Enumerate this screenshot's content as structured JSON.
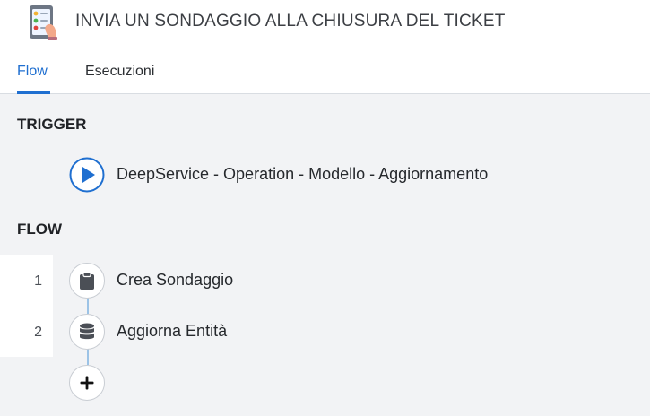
{
  "header": {
    "title": "INVIA UN SONDAGGIO ALLA CHIUSURA DEL TICKET",
    "icon": "survey-tablet-icon"
  },
  "tabs": [
    {
      "label": "Flow",
      "active": true
    },
    {
      "label": "Esecuzioni",
      "active": false
    }
  ],
  "trigger": {
    "section_label": "TRIGGER",
    "name": "DeepService - Operation - Modello - Aggiornamento",
    "icon": "play-icon"
  },
  "flow": {
    "section_label": "FLOW",
    "steps": [
      {
        "number": "1",
        "label": "Crea Sondaggio",
        "icon": "clipboard-icon"
      },
      {
        "number": "2",
        "label": "Aggiorna Entità",
        "icon": "database-icon"
      }
    ],
    "add_icon": "plus-icon"
  },
  "colors": {
    "accent": "#1f6fd0",
    "connector": "#9cc3e6",
    "background": "#f2f3f5"
  }
}
